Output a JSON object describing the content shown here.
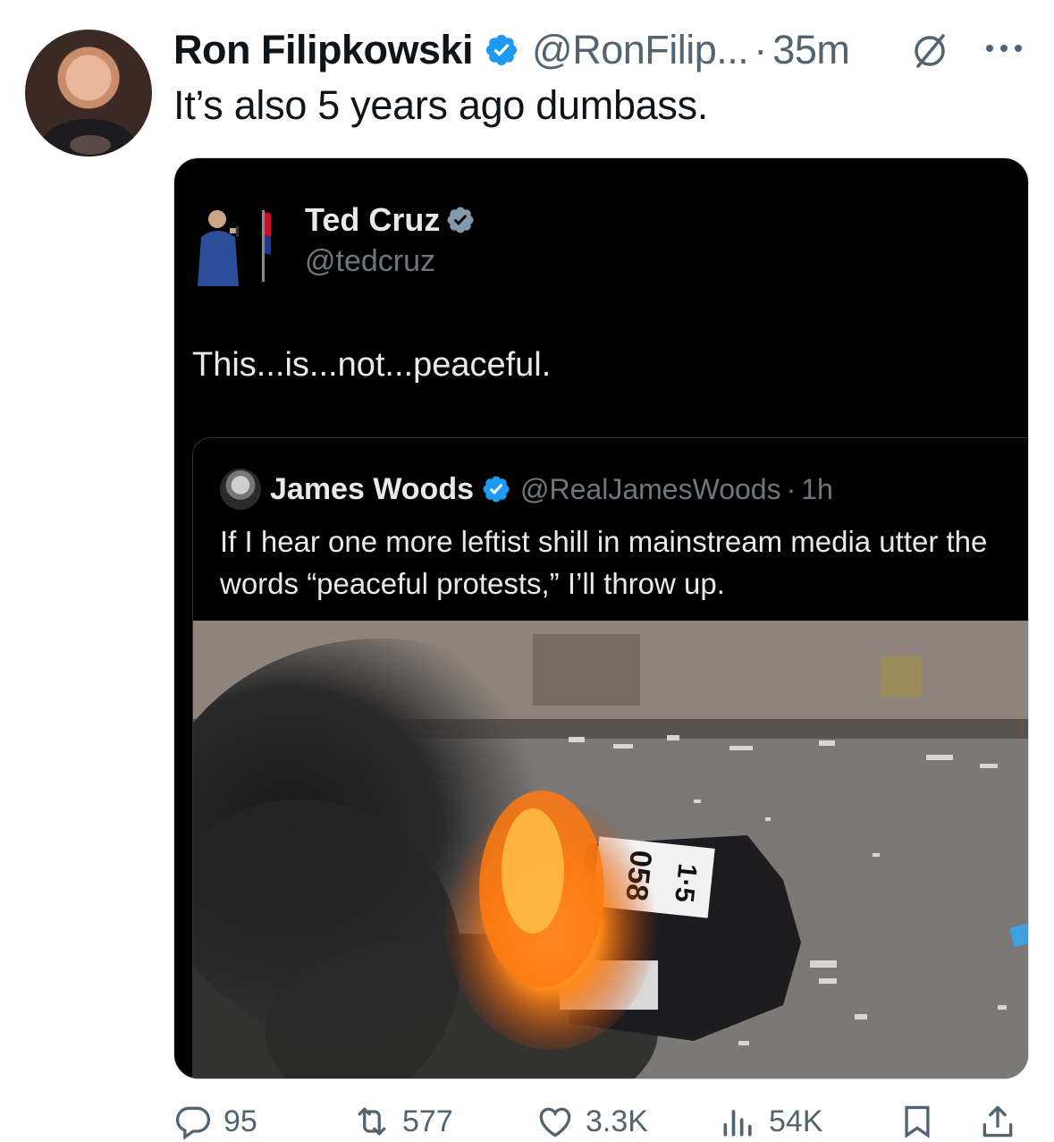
{
  "tweet": {
    "author_name": "Ron Filipkowski",
    "author_handle": "@RonFilip...",
    "separator": "·",
    "time": "35m",
    "text": "It’s also 5 years ago dumbass."
  },
  "quoted_screenshot": {
    "author_name": "Ted Cruz",
    "author_handle": "@tedcruz",
    "text": "This...is...not...peaceful.",
    "nested_quote": {
      "author_name": "James Woods",
      "author_handle": "@RealJamesWoods",
      "separator": "·",
      "time": "1h",
      "text": "If I hear one more leftist shill in mainstream media utter the words “peaceful protests,” I’ll throw up.",
      "media_description_icon": "burning-police-car-video",
      "car_roof_number": "0 5 8  1·5"
    }
  },
  "actions": {
    "replies": "95",
    "retweets": "577",
    "likes": "3.3K",
    "views": "54K"
  },
  "colors": {
    "verified_blue": "#1d9bf0",
    "verified_gray": "#829aab",
    "muted_text": "#536471"
  }
}
